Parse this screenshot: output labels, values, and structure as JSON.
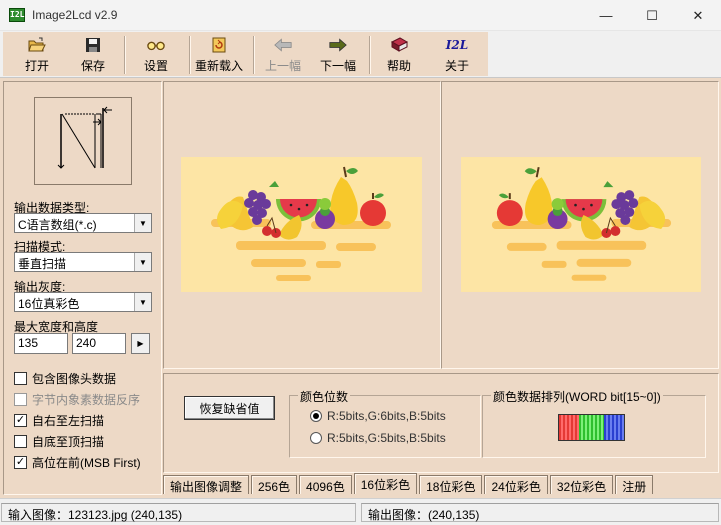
{
  "window": {
    "title": "Image2Lcd v2.9",
    "icon_text": "I2L",
    "minimize_symbol": "—",
    "maximize_symbol": "☐",
    "close_symbol": "✕"
  },
  "toolbar": {
    "open": "打开",
    "save": "保存",
    "settings": "设置",
    "reload": "重新载入",
    "prev": "上一幅",
    "next": "下一幅",
    "help": "帮助",
    "about": "关于",
    "about_icon_text": "I2L"
  },
  "left_panel": {
    "output_type_label": "输出数据类型:",
    "output_type_value": "C语言数组(*.c)",
    "scan_mode_label": "扫描模式:",
    "scan_mode_value": "垂直扫描",
    "gray_label": "输出灰度:",
    "gray_value": "16位真彩色",
    "size_label": "最大宽度和高度",
    "max_width": "135",
    "max_height": "240",
    "size_btn_symbol": "▶",
    "checkboxes": [
      {
        "label": "包含图像头数据",
        "checked": false,
        "disabled": false
      },
      {
        "label": "字节内象素数据反序",
        "checked": false,
        "disabled": true
      },
      {
        "label": "自右至左扫描",
        "checked": true,
        "disabled": false
      },
      {
        "label": "自底至顶扫描",
        "checked": false,
        "disabled": false
      },
      {
        "label": "高位在前(MSB First)",
        "checked": true,
        "disabled": false
      }
    ],
    "check_mark": "✓"
  },
  "controls": {
    "restore_default": "恢复缺省值",
    "color_bits_title": "颜色位数",
    "radio_565": "R:5bits,G:6bits,B:5bits",
    "radio_555": "R:5bits,G:5bits,B:5bits",
    "order_title": "颜色数据排列(WORD bit[15~0])"
  },
  "tabs": [
    "输出图像调整",
    "256色",
    "4096色",
    "16位彩色",
    "18位彩色",
    "24位彩色",
    "32位彩色",
    "注册"
  ],
  "active_tab": 3,
  "status": {
    "input": "输入图像：123123.jpg (240,135)",
    "output": "输出图像：(240,135)"
  },
  "colors": {
    "panel": "#edd9c6",
    "image_bg": "#fde5a5",
    "bit_red": "#e53935",
    "bit_green": "#43d14a",
    "bit_blue": "#3b4fd8"
  }
}
